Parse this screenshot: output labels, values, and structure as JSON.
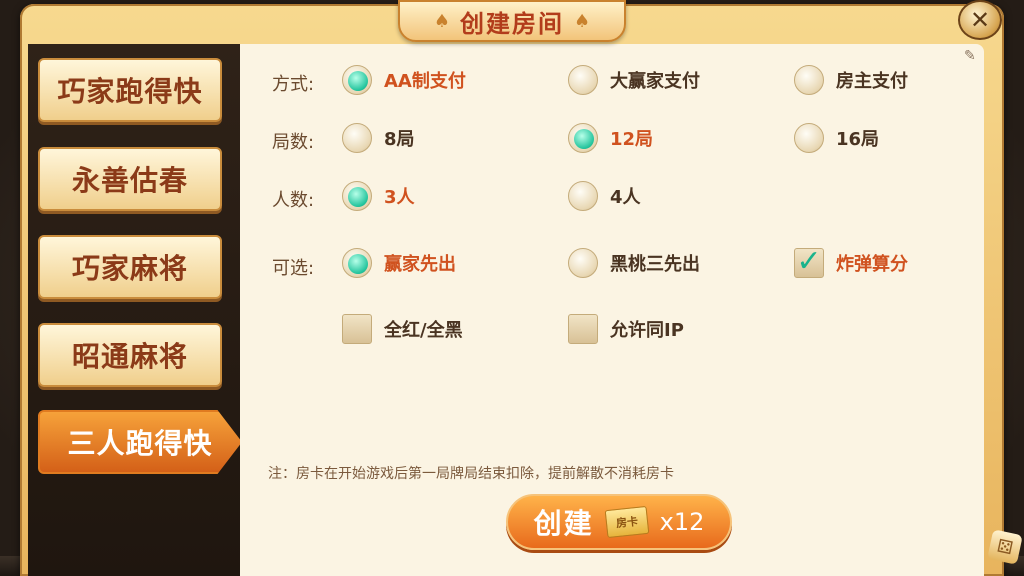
{
  "dialog": {
    "title": "创建房间",
    "close_glyph": "✕",
    "title_left_icon": "spade-icon",
    "title_right_icon": "spade-icon"
  },
  "sidebar": {
    "items": [
      {
        "label": "巧家跑得快",
        "active": false
      },
      {
        "label": "永善估春",
        "active": false
      },
      {
        "label": "巧家麻将",
        "active": false
      },
      {
        "label": "昭通麻将",
        "active": false
      },
      {
        "label": "三人跑得快",
        "active": true
      }
    ]
  },
  "rules": {
    "payment": {
      "label": "方式:",
      "options": [
        {
          "text": "AA制支付",
          "selected": true
        },
        {
          "text": "大赢家支付",
          "selected": false
        },
        {
          "text": "房主支付",
          "selected": false
        }
      ]
    },
    "rounds": {
      "label": "局数:",
      "options": [
        {
          "text": "8局",
          "selected": false
        },
        {
          "text": "12局",
          "selected": true
        },
        {
          "text": "16局",
          "selected": false
        }
      ]
    },
    "players": {
      "label": "人数:",
      "options": [
        {
          "text": "3人",
          "selected": true
        },
        {
          "text": "4人",
          "selected": false
        }
      ]
    },
    "optional": {
      "label": "可选:",
      "options": [
        {
          "text": "赢家先出",
          "selected": true
        },
        {
          "text": "黑桃三先出",
          "selected": false
        }
      ],
      "checkboxes": [
        {
          "text": "炸弹算分",
          "checked": true
        },
        {
          "text": "全红/全黑",
          "checked": false
        },
        {
          "text": "允许同IP",
          "checked": false
        }
      ]
    }
  },
  "note": "注：房卡在开始游戏后第一局牌局结束扣除，提前解散不消耗房卡",
  "create": {
    "label": "创建",
    "card_icon_text": "房卡",
    "count": "x12"
  },
  "colors": {
    "accent": "#d0521f",
    "selected_radio": "#23c49d",
    "panel_bg": "#fbf4e3"
  }
}
